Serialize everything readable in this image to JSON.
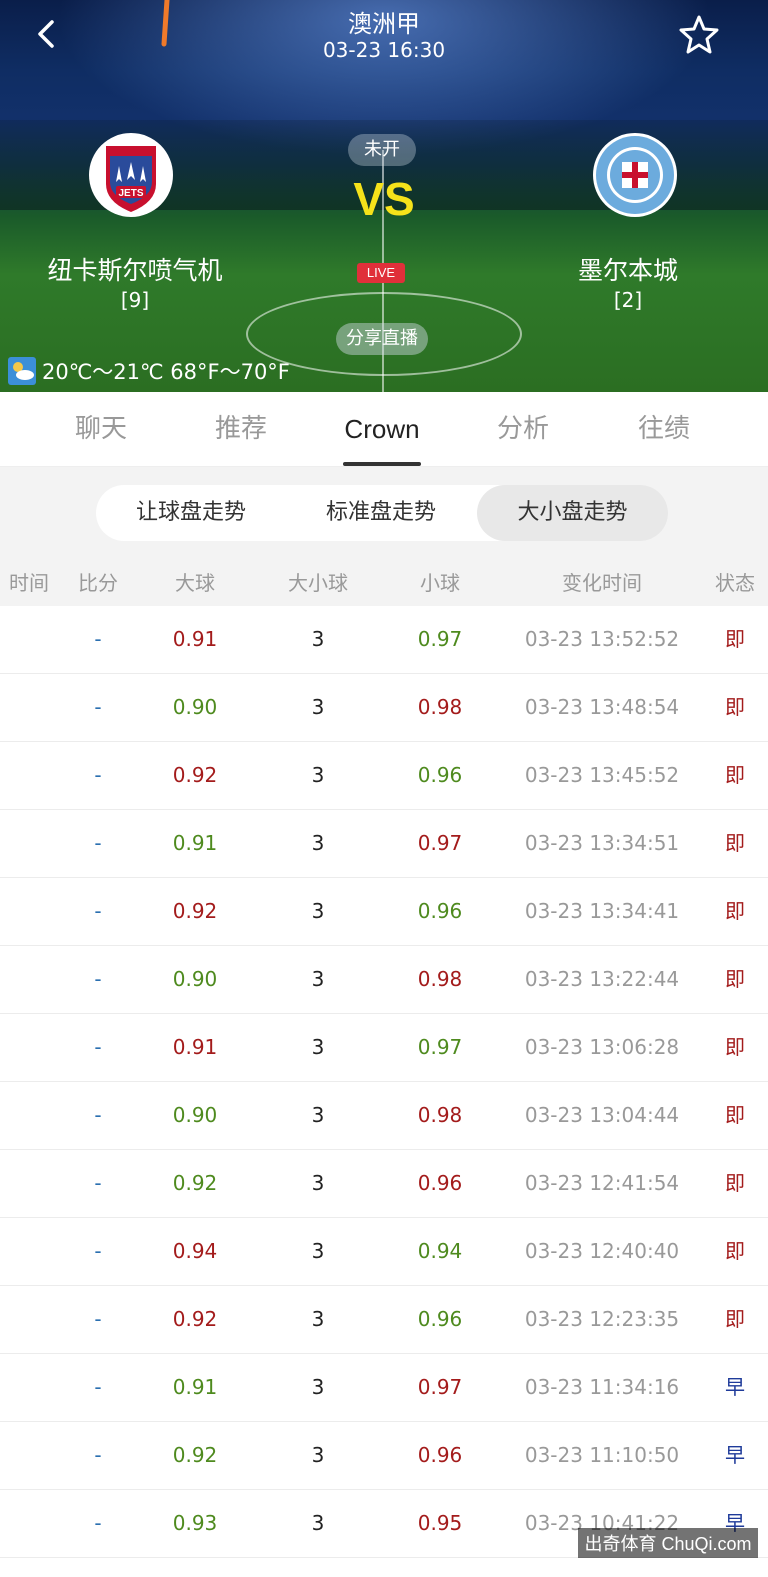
{
  "header": {
    "league": "澳洲甲",
    "datetime": "03-23 16:30",
    "status": "未开",
    "vs": "VS",
    "live": "LIVE",
    "share": "分享直播",
    "weather": "20℃～21℃  68°F～70°F",
    "home": {
      "name": "纽卡斯尔喷气机",
      "rank": "[9]",
      "logo_text": "JETS",
      "logo_top": "NEWCASTLE UNITED"
    },
    "away": {
      "name": "墨尔本城",
      "rank": "[2]",
      "logo_text": "MELBOURNE CITY"
    },
    "icons": {
      "back": "back-arrow-icon",
      "favorite": "star-outline-icon",
      "weather": "weather-icon"
    }
  },
  "tabs": [
    "聊天",
    "推荐",
    "Crown",
    "分析",
    "往绩"
  ],
  "active_tab": "Crown",
  "sub_tabs": [
    "让球盘走势",
    "标准盘走势",
    "大小盘走势"
  ],
  "active_sub_tab": "大小盘走势",
  "table": {
    "headers": [
      "时间",
      "比分",
      "大球",
      "大小球",
      "小球",
      "变化时间",
      "状态"
    ],
    "rows": [
      {
        "time": "",
        "score": "-",
        "over": "0.91",
        "line": "3",
        "under": "0.97",
        "changed": "03-23 13:52:52",
        "status": "即",
        "over_color": "red",
        "under_color": "green"
      },
      {
        "time": "",
        "score": "-",
        "over": "0.90",
        "line": "3",
        "under": "0.98",
        "changed": "03-23 13:48:54",
        "status": "即",
        "over_color": "green",
        "under_color": "red"
      },
      {
        "time": "",
        "score": "-",
        "over": "0.92",
        "line": "3",
        "under": "0.96",
        "changed": "03-23 13:45:52",
        "status": "即",
        "over_color": "red",
        "under_color": "green"
      },
      {
        "time": "",
        "score": "-",
        "over": "0.91",
        "line": "3",
        "under": "0.97",
        "changed": "03-23 13:34:51",
        "status": "即",
        "over_color": "green",
        "under_color": "red"
      },
      {
        "time": "",
        "score": "-",
        "over": "0.92",
        "line": "3",
        "under": "0.96",
        "changed": "03-23 13:34:41",
        "status": "即",
        "over_color": "red",
        "under_color": "green"
      },
      {
        "time": "",
        "score": "-",
        "over": "0.90",
        "line": "3",
        "under": "0.98",
        "changed": "03-23 13:22:44",
        "status": "即",
        "over_color": "green",
        "under_color": "red"
      },
      {
        "time": "",
        "score": "-",
        "over": "0.91",
        "line": "3",
        "under": "0.97",
        "changed": "03-23 13:06:28",
        "status": "即",
        "over_color": "red",
        "under_color": "green"
      },
      {
        "time": "",
        "score": "-",
        "over": "0.90",
        "line": "3",
        "under": "0.98",
        "changed": "03-23 13:04:44",
        "status": "即",
        "over_color": "green",
        "under_color": "red"
      },
      {
        "time": "",
        "score": "-",
        "over": "0.92",
        "line": "3",
        "under": "0.96",
        "changed": "03-23 12:41:54",
        "status": "即",
        "over_color": "green",
        "under_color": "red"
      },
      {
        "time": "",
        "score": "-",
        "over": "0.94",
        "line": "3",
        "under": "0.94",
        "changed": "03-23 12:40:40",
        "status": "即",
        "over_color": "red",
        "under_color": "green"
      },
      {
        "time": "",
        "score": "-",
        "over": "0.92",
        "line": "3",
        "under": "0.96",
        "changed": "03-23 12:23:35",
        "status": "即",
        "over_color": "red",
        "under_color": "green"
      },
      {
        "time": "",
        "score": "-",
        "over": "0.91",
        "line": "3",
        "under": "0.97",
        "changed": "03-23 11:34:16",
        "status": "早",
        "over_color": "green",
        "under_color": "red"
      },
      {
        "time": "",
        "score": "-",
        "over": "0.92",
        "line": "3",
        "under": "0.96",
        "changed": "03-23 11:10:50",
        "status": "早",
        "over_color": "green",
        "under_color": "red"
      },
      {
        "time": "",
        "score": "-",
        "over": "0.93",
        "line": "3",
        "under": "0.95",
        "changed": "03-23 10:41:22",
        "status": "早",
        "over_color": "green",
        "under_color": "red"
      }
    ]
  },
  "watermark": "出奇体育 ChuQi.com",
  "colors": {
    "red": "#a31b1b",
    "green": "#4e8a1e",
    "score_blue": "#2a6fb0",
    "vs_yellow": "#f6e21a",
    "live_red": "#e0303a"
  }
}
